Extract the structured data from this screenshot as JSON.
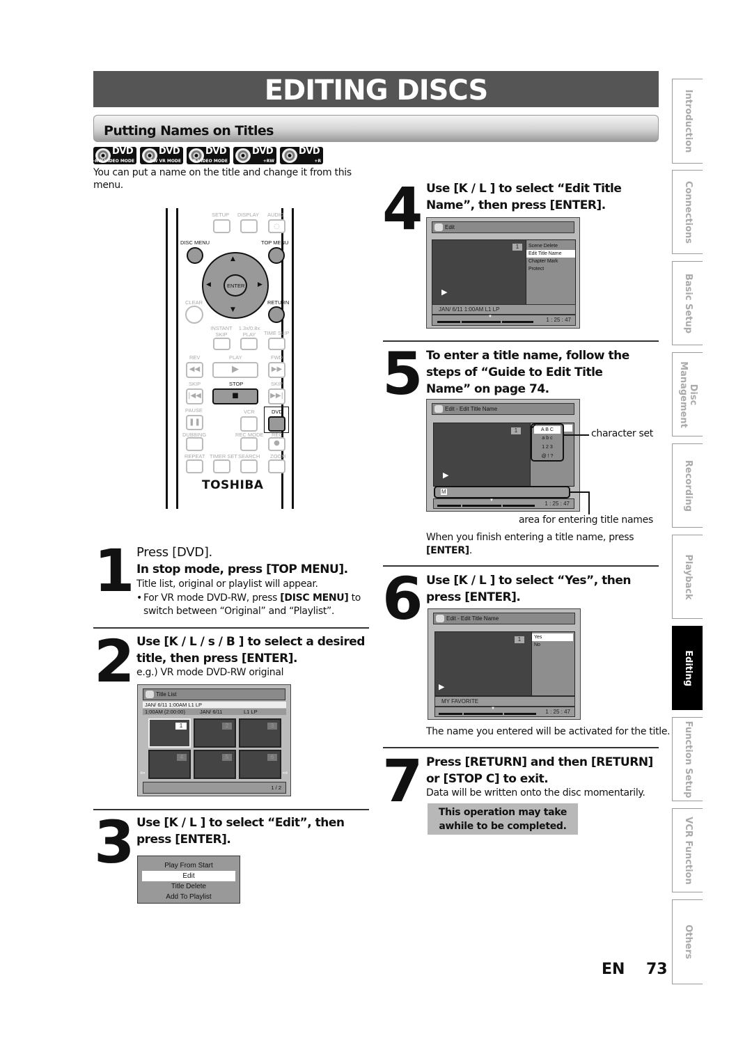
{
  "header": {
    "title": "EDITING DISCS",
    "section": "Putting Names on Titles"
  },
  "badges": [
    {
      "label": "DVD",
      "sub": "-RW VIDEO MODE"
    },
    {
      "label": "DVD",
      "sub": "-RW VR MODE"
    },
    {
      "label": "DVD",
      "sub": "-R VIDEO MODE"
    },
    {
      "label": "DVD",
      "sub": "+RW"
    },
    {
      "label": "DVD",
      "sub": "+R"
    }
  ],
  "intro": "You can put a name on the title and change it from this menu.",
  "remote": {
    "brand": "TOSHIBA",
    "labels": {
      "setup": "SETUP",
      "display": "DISPLAY",
      "audio": "AUDIO",
      "disc_menu": "DISC MENU",
      "top_menu": "TOP MENU",
      "enter": "ENTER",
      "clear": "CLEAR",
      "return": "RETURN",
      "instant_skip": "INSTANT SKIP",
      "play_speed": "1.3x/0.8x PLAY",
      "time_slip": "TIME SLIP",
      "rev": "REV",
      "play": "PLAY",
      "fwd": "FWD",
      "skip_back": "SKIP",
      "stop": "STOP",
      "skip_fwd": "SKIP",
      "pause": "PAUSE",
      "vcr": "VCR",
      "dvd": "DVD",
      "dubbing": "DUBBING",
      "rec_mode": "REC MODE",
      "rec": "REC",
      "repeat": "REPEAT",
      "timer_set": "TIMER SET",
      "search": "SEARCH",
      "zoom": "ZOOM"
    }
  },
  "steps": {
    "s1": {
      "num": "1",
      "press": "Press [DVD].",
      "title": "In stop mode, press [TOP MENU].",
      "text": "Title list, original or playlist will appear.",
      "bullet_pre": "For VR mode DVD-RW, press ",
      "bullet_bold": "[DISC MENU]",
      "bullet_post": " to switch between “Original” and “Playlist”."
    },
    "s2": {
      "num": "2",
      "title": "Use [K / L / s  / B ] to select a desired title, then press [ENTER].",
      "text": "e.g.) VR mode DVD-RW original"
    },
    "s3": {
      "num": "3",
      "title": "Use [K / L ] to select “Edit”, then press [ENTER]."
    },
    "s4": {
      "num": "4",
      "title": "Use [K / L ] to select “Edit Title Name”, then press [ENTER]."
    },
    "s5": {
      "num": "5",
      "title": "To enter a title name, follow the steps of “Guide to Edit Title Name” on page 74.",
      "after": "When you finish entering a title name, press",
      "after_bold": "[ENTER]",
      "after_end": "."
    },
    "s6": {
      "num": "6",
      "title": "Use [K / L ] to select “Yes”, then press [ENTER].",
      "after": "The name you entered will be activated for the title."
    },
    "s7": {
      "num": "7",
      "title": "Press [RETURN] and then [RETURN] or [STOP C] to exit.",
      "text": "Data will be written onto the disc momentarily.",
      "note": "This operation may take awhile to be completed."
    }
  },
  "title_list": {
    "title": "Title List",
    "row1": "JAN/ 6/11 1:00AM  L1   LP",
    "row2_a": "1:00AM (2:00:00)",
    "row2_b": "JAN/ 6/11",
    "row2_c": "L1   LP",
    "thumbs": [
      "1",
      "2",
      "3",
      "4",
      "5",
      "6"
    ],
    "page": "1 / 2"
  },
  "popup_menu": {
    "items": [
      "Play From Start",
      "Edit",
      "Title Delete",
      "Add To Playlist"
    ],
    "selected": "Edit"
  },
  "edit_screen": {
    "title": "Edit",
    "num": "1",
    "menu": [
      "Scene Delete",
      "Edit Title Name",
      "Chapter Mark",
      "Protect"
    ],
    "selected": "Edit Title Name",
    "info": "JAN/ 6/11 1:00AM L1   LP",
    "time": "1 : 25 : 47"
  },
  "edit_name_screen": {
    "title": "Edit - Edit Title Name",
    "num": "1",
    "charset": [
      "A  B  C",
      "a  b  c",
      "1  2  3",
      "@  !  ?"
    ],
    "input": "M",
    "time": "1 : 25 : 47",
    "callout_charset": "character set",
    "callout_area": "area for entering title names"
  },
  "confirm_screen": {
    "title": "Edit - Edit Title Name",
    "num": "1",
    "options": [
      "Yes",
      "No"
    ],
    "selected": "Yes",
    "name": "MY FAVORITE",
    "time": "1 : 25 : 47"
  },
  "side_tabs": [
    {
      "label": "Introduction",
      "active": false
    },
    {
      "label": "Connections",
      "active": false
    },
    {
      "label": "Basic Setup",
      "active": false
    },
    {
      "label": "Disc Management",
      "active": false
    },
    {
      "label": "Recording",
      "active": false
    },
    {
      "label": "Playback",
      "active": false
    },
    {
      "label": "Editing",
      "active": true
    },
    {
      "label": "Function Setup",
      "active": false
    },
    {
      "label": "VCR Function",
      "active": false
    },
    {
      "label": "Others",
      "active": false
    }
  ],
  "footer": {
    "lang": "EN",
    "page": "73"
  }
}
